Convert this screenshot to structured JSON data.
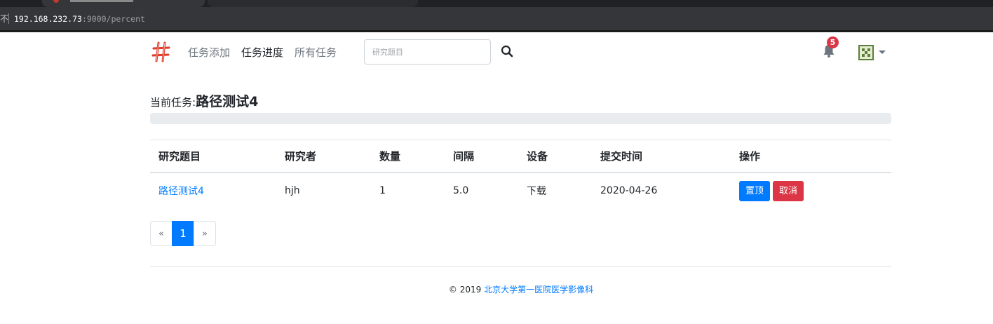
{
  "browser": {
    "security_prefix": "不",
    "url_host": "192.168.232.73",
    "url_path": ":9000/percent"
  },
  "navbar": {
    "brand_icon": "hash-logo-icon",
    "links": [
      "任务添加",
      "任务进度",
      "所有任务"
    ],
    "active_link": "任务进度",
    "search": {
      "placeholder": "研究题目",
      "value": ""
    },
    "search_icon": "search-icon",
    "notifications": {
      "icon": "bell-icon",
      "count": "5"
    },
    "user": {
      "icon": "avatar-icon"
    }
  },
  "task": {
    "prefix": "当前任务:",
    "name": "路径测试4",
    "progress": 0
  },
  "table": {
    "headers": [
      "研究题目",
      "研究者",
      "数量",
      "间隔",
      "设备",
      "提交时间",
      "操作"
    ],
    "rows": [
      {
        "title": "路径测试4",
        "researcher": "hjh",
        "count": "1",
        "interval": "5.0",
        "device": "下载",
        "submitted": "2020-04-26",
        "actions": [
          "置顶",
          "取消"
        ]
      }
    ]
  },
  "pagination": {
    "prev": "«",
    "current": "1",
    "next": "»"
  },
  "footer": {
    "copyright": "© 2019 ",
    "org": "北京大学第一医院医学影像科"
  },
  "colors": {
    "primary": "#007bff",
    "danger": "#dc3545",
    "brand": "#e03b2b",
    "progress_track": "#e9ecef"
  }
}
